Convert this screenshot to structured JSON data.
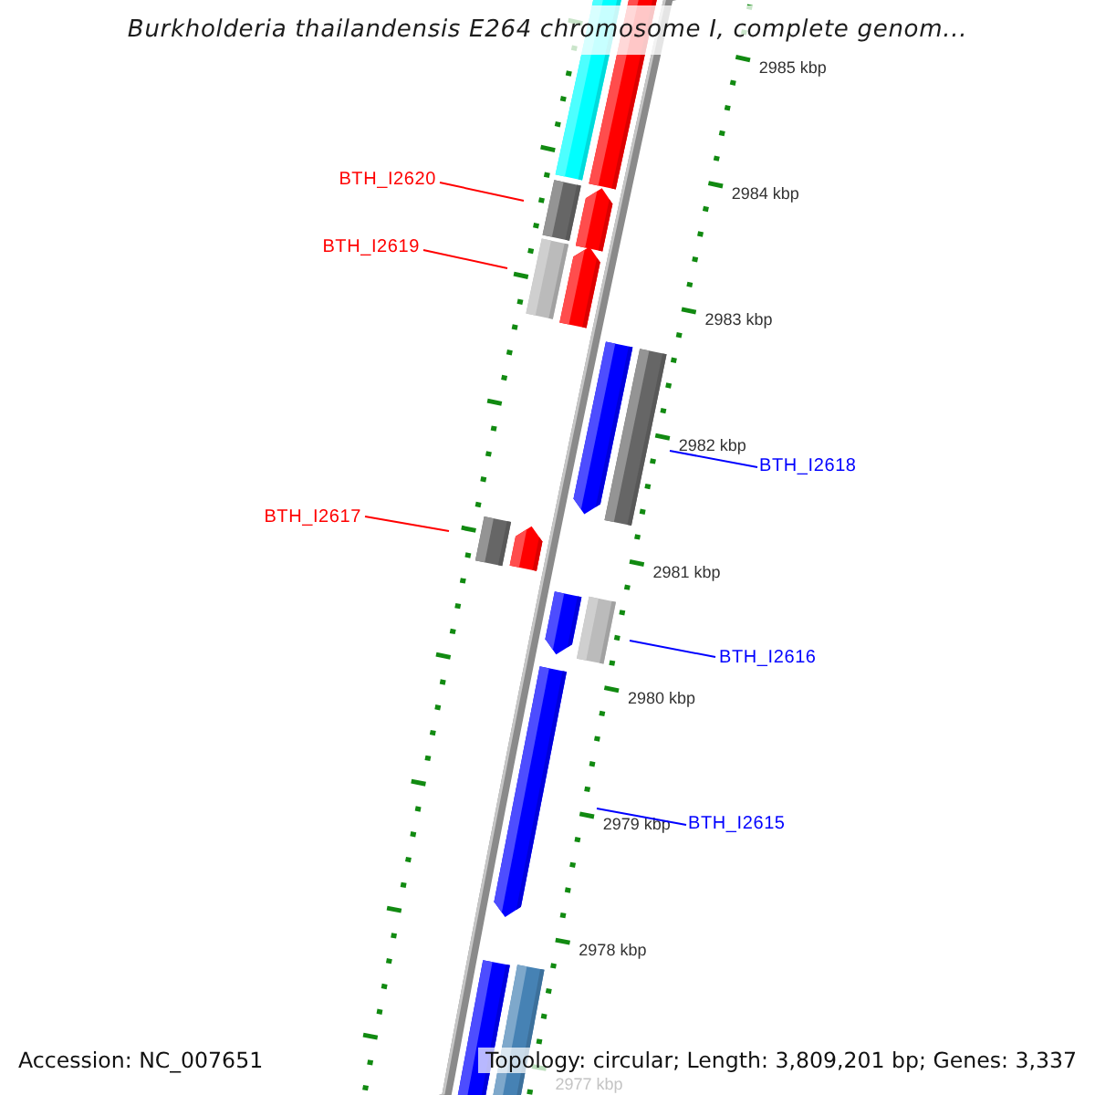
{
  "title": "Burkholderia thailandensis E264 chromosome I, complete genom...",
  "map": {
    "scale_labels": [
      "2985 kbp",
      "2984 kbp",
      "2983 kbp",
      "2982 kbp",
      "2981 kbp",
      "2980 kbp",
      "2979 kbp",
      "2978 kbp",
      "2977 kbp"
    ],
    "features": [
      {
        "kind": "bar",
        "color": "#00ffff"
      },
      {
        "kind": "arrow",
        "color": "#ff0000"
      },
      {
        "kind": "bar",
        "color": "#666666"
      },
      {
        "kind": "arrow",
        "color": "#ff0000"
      },
      {
        "kind": "bar",
        "color": "#bbbbbb"
      },
      {
        "kind": "arrow",
        "color": "#ff0000"
      },
      {
        "kind": "arrow",
        "color": "#0000ff"
      },
      {
        "kind": "bar",
        "color": "#666666"
      },
      {
        "kind": "bar",
        "color": "#666666"
      },
      {
        "kind": "arrow",
        "color": "#ff0000"
      },
      {
        "kind": "arrow",
        "color": "#0000ff"
      },
      {
        "kind": "bar",
        "color": "#bbbbbb"
      },
      {
        "kind": "arrow",
        "color": "#0000ff"
      },
      {
        "kind": "arrow",
        "color": "#0000ff"
      },
      {
        "kind": "bar",
        "color": "#4682b4"
      }
    ],
    "gene_labels": [
      {
        "text": "BTH_I2620",
        "color": "#ff0000"
      },
      {
        "text": "BTH_I2619",
        "color": "#ff0000"
      },
      {
        "text": "BTH_I2618",
        "color": "#0000ff"
      },
      {
        "text": "BTH_I2617",
        "color": "#ff0000"
      },
      {
        "text": "BTH_I2616",
        "color": "#0000ff"
      },
      {
        "text": "BTH_I2615",
        "color": "#0000ff"
      }
    ]
  },
  "status_bar": {
    "accession": "Accession: NC_007651",
    "summary": "Topology: circular; Length: 3,809,201 bp; Genes: 3,337"
  }
}
